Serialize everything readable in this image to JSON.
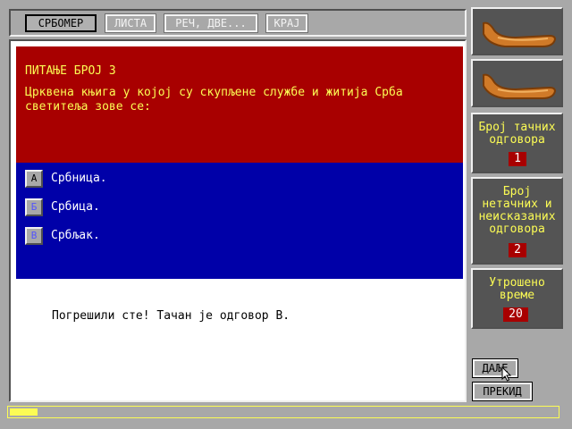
{
  "menu": {
    "items": [
      {
        "label": "СРБОМЕР",
        "active": true
      },
      {
        "label": "ЛИСТА",
        "active": false
      },
      {
        "label": "РЕЧ, ДВЕ...",
        "active": false
      },
      {
        "label": "КРАЈ",
        "active": false
      }
    ]
  },
  "question": {
    "title": "ПИТАЊЕ БРОЈ 3",
    "text": "Црквена књига у којој су скупљене службе и житија Срба\nсветитеља зове се:",
    "answers": [
      {
        "key": "А",
        "text": "Србница."
      },
      {
        "key": "Б",
        "text": "Србица."
      },
      {
        "key": "В",
        "text": "Србљак."
      }
    ]
  },
  "feedback": "Погрешили сте! Тачан је одговор В.",
  "sidebar": {
    "logo_icon": "boat-icon",
    "correct": {
      "label": "Број тачних\nодговора",
      "value": "1"
    },
    "incorrect": {
      "label": "Број\nнетачних и\nнеисказаних\nодговора",
      "value": "2"
    },
    "time": {
      "label": "Утрошено\nвреме",
      "value": "20"
    }
  },
  "buttons": {
    "next": "ДАЉЕ",
    "stop": "ПРЕКИД"
  },
  "progress": {
    "fraction": 0.05
  },
  "colors": {
    "red": "#a80000",
    "blue": "#0000a8",
    "yellow": "#fcfc54",
    "panel_gray": "#545454"
  }
}
